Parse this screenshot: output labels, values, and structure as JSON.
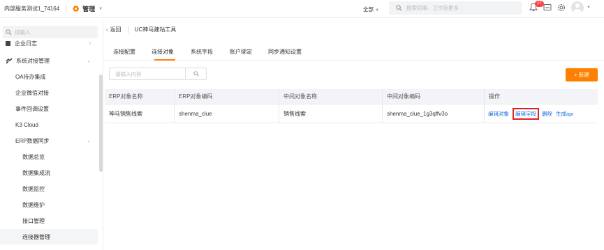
{
  "topbar": {
    "app_name": "内部服务测试1_74164",
    "module": "管理",
    "scope": "全部",
    "search_placeholder": "搜索同事、工作及更多",
    "notification_count": "17"
  },
  "sidebar": {
    "search_placeholder": "请输入",
    "items": [
      {
        "label": "企业日志"
      },
      {
        "label": "系统对接管理"
      },
      {
        "label": "OA待办集成"
      },
      {
        "label": "企业微信对接"
      },
      {
        "label": "事件回调设置"
      },
      {
        "label": "K3 Cloud"
      },
      {
        "label": "ERP数据同步"
      },
      {
        "label": "数据总览"
      },
      {
        "label": "数据集成流"
      },
      {
        "label": "数据监控"
      },
      {
        "label": "数据维护"
      },
      {
        "label": "接口管理"
      },
      {
        "label": "连接器管理"
      }
    ]
  },
  "main": {
    "back_label": "返回",
    "page_title": "UC神马建站工具",
    "tabs": [
      "连接配置",
      "连接对象",
      "系统字段",
      "账户绑定",
      "同步通知设置"
    ],
    "active_tab": 1,
    "table_search_placeholder": "请输入内容",
    "new_button": "+ 新建",
    "table": {
      "headers": [
        "ERP对象名称",
        "ERP对象编码",
        "中间对象名称",
        "中间对象编码",
        "操作"
      ],
      "rows": [
        {
          "erp_name": "神马销售线索",
          "erp_code": "shenma_clue",
          "mid_name": "销售线索",
          "mid_code": "shenma_clue_1g3qffv3o",
          "ops": [
            "编辑对象",
            "编辑字段",
            "删除",
            "生成api"
          ]
        }
      ]
    }
  },
  "colors": {
    "accent": "#ff8000",
    "link": "#1a6de0",
    "highlight": "#e02020"
  }
}
